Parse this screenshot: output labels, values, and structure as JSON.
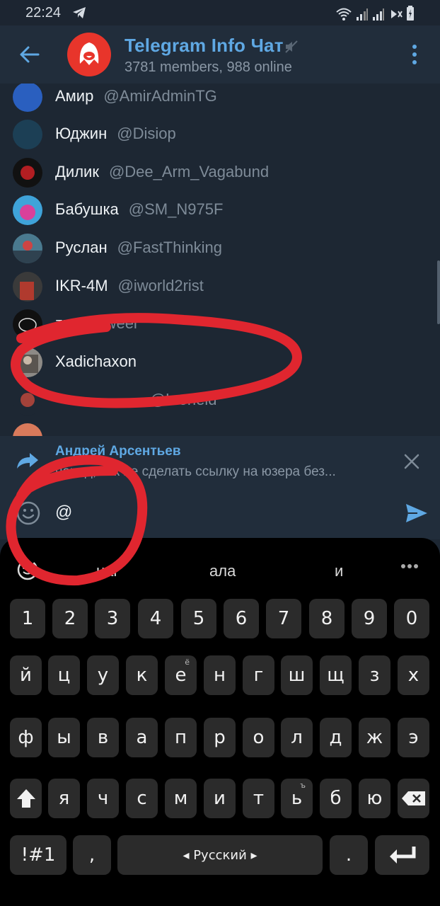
{
  "status_bar": {
    "time": "22:24"
  },
  "header": {
    "title": "Telegram Info Чат",
    "subtitle": "3781 members, 988 online"
  },
  "mentions": [
    {
      "name": "Амир",
      "handle": "@AmirAdminTG",
      "avatar_color": "#2a5fbf"
    },
    {
      "name": "Юджин",
      "handle": "@Disiop",
      "avatar_color": "#1c3f55"
    },
    {
      "name": "Дилик",
      "handle": "@Dee_Arm_Vagabund",
      "avatar_color": "#b21e22"
    },
    {
      "name": "Бабушка",
      "handle": "@SM_N975F",
      "avatar_color": "#3fa3d9"
    },
    {
      "name": "Руслан",
      "handle": "@FastThinking",
      "avatar_color": "#4a7a8f"
    },
    {
      "name": "IKR-4M",
      "handle": "@iworld2rist",
      "avatar_color": "#b03a2e"
    },
    {
      "name": "zz",
      "handle": "@2weer",
      "avatar_color": "#101010"
    },
    {
      "name": "Xadichaxon",
      "handle": "",
      "avatar_color": "#8d8a86"
    },
    {
      "name": "",
      "handle": "@kroneid",
      "avatar_color": "#a3423a"
    },
    {
      "name": "",
      "handle": "",
      "avatar_color": "#d97a5b"
    }
  ],
  "reply": {
    "author": "Андрей Арсентьев",
    "text": "народ, как не сделать ссылку на юзера без..."
  },
  "input": {
    "value": "@"
  },
  "keyboard": {
    "suggestions": [
      "наг",
      "ала",
      "и"
    ],
    "rows": [
      {
        "keys": [
          "1",
          "2",
          "3",
          "4",
          "5",
          "6",
          "7",
          "8",
          "9",
          "0"
        ]
      },
      {
        "keys": [
          "й",
          "ц",
          "у",
          "к",
          "е",
          "н",
          "г",
          "ш",
          "щ",
          "з",
          "х"
        ]
      },
      {
        "keys": [
          "ф",
          "ы",
          "в",
          "а",
          "п",
          "р",
          "о",
          "л",
          "д",
          "ж",
          "э"
        ]
      },
      {
        "keys": [
          "я",
          "ч",
          "с",
          "м",
          "и",
          "т",
          "ь",
          "б",
          "ю"
        ]
      }
    ],
    "hint_e": "ё",
    "hint_soft": "ъ",
    "symbols_label": "!#1",
    "comma_label": ",",
    "language_label": "Русский",
    "period_label": "."
  },
  "colors": {
    "accent": "#5fa8e3",
    "annotation": "#e0262f"
  }
}
